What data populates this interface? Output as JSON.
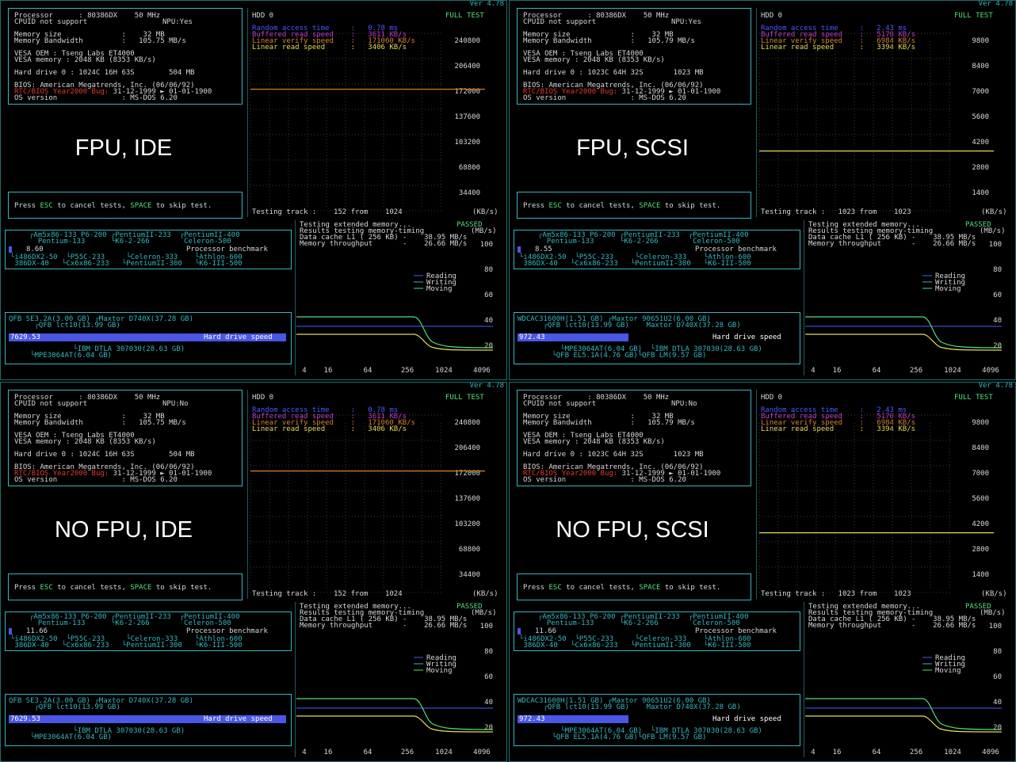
{
  "version": "Ver 4.78",
  "quads": [
    {
      "id": "q1",
      "label": "FPU, IDE",
      "npu": "NPU:Yes",
      "sys": {
        "processor": "Processor      : 80386DX    50 MHz",
        "cpuid": "CPUID not support",
        "mem_size": "Memory size              :    32 MB",
        "mem_bw": "Memory Bandwidth         :   105.75 MB/s",
        "vesa_oem": "VESA OEM : Tseng Labs ET4000",
        "vesa_mem": "VESA memory : 2048 KB (8353 KB/s)",
        "hd": "Hard drive 0 : 1024C 16H 63S        504 MB",
        "bios": "BIOS: American Megatrends, Inc. (06/06/92)",
        "y2k_red": "RTC/BIOS Year2000 Bug:",
        "y2k_rest": " 31-12-1999 ► 01-01-1900",
        "os": "OS version               : MS-DOS 6.20"
      },
      "press": {
        "a": "Press ",
        "esc": "ESC",
        "b": " to cancel tests, ",
        "space": "SPACE",
        "c": " to skip test."
      },
      "hdd": {
        "title": "HDD 0",
        "full": "FULL TEST",
        "rat": "Random access time     :   0.78 ms",
        "brs": "Buffered read speed    :   3611 KB/s",
        "lvs": "Linear verify speed    :   171060 KB/s",
        "lrs": "Linear read speed      :   3406 KB/s",
        "yticks": [
          "240800",
          "206400",
          "172000",
          "137600",
          "103200",
          "68800",
          "34400"
        ],
        "track": "Testing track :    152 from    1024",
        "unit": "(KB/s)",
        "line_level_pct": 0.714,
        "line_color": "#d8812a"
      },
      "bench": {
        "top1": "┌Am5x86-133 P6-200 ┌PentiumII-233  ┌PentiumII-400",
        "top2": "  Pentium-133      └K6-2-266        Celeron-500",
        "score": "8.60",
        "score_frac": 0.0,
        "cap": "Processor benchmark",
        "bot1": "└i486DX2-50  └P55C-233     └Celeron-333    └Athlon-600",
        "bot2": " 386DX-40   └Cx6x86-233   └PentiumII-300   └K6-III-500"
      },
      "hdbench": {
        "top1": "QFB SE3.2A(3.00 GB) ┌Maxtor D740X(37.28 GB)",
        "top2": "      ┌QFB lct10(13.99 GB)",
        "score": "7629.53",
        "bar_frac": 1.0,
        "cap": "Hard drive speed",
        "bot1": "               └IBM DTLA 307030(28.63 GB)",
        "bot2": "     └MPE3064AT(6.04 GB)"
      },
      "memtest": {
        "l1": "Testing extended memory...",
        "passed": "PASSED",
        "l2": "Results testing memory-timing",
        "unit": "(MB/s)",
        "l3": "Data cache L1 ( 256 KB) -    38.95 MB/s",
        "l4": "Memory throughput       -    26.66 MB/s",
        "yticks": [
          "100",
          "80",
          "60",
          "40",
          "20"
        ],
        "xticks": [
          "4",
          "16",
          "64",
          "256",
          "1024",
          "4096"
        ],
        "legend": [
          "Reading",
          "Writing",
          "Moving"
        ]
      }
    },
    {
      "id": "q2",
      "label": "FPU, SCSI",
      "npu": "NPU:Yes",
      "sys": {
        "processor": "Processor      : 80386DX    50 MHz",
        "cpuid": "CPUID not support",
        "mem_size": "Memory size              :    32 MB",
        "mem_bw": "Memory Bandwidth         :   105.79 MB/s",
        "vesa_oem": "VESA OEM : Tseng Labs ET4000",
        "vesa_mem": "VESA memory : 2048 KB (8353 KB/s)",
        "hd": "Hard drive 0 : 1023C 64H 32S       1023 MB",
        "bios": "BIOS: American Megatrends, Inc. (06/06/92)",
        "y2k_red": "RTC/BIOS Year2000 Bug:",
        "y2k_rest": " 31-12-1999 ► 01-01-1900",
        "os": "OS version               : MS-DOS 6.20"
      },
      "press": {
        "a": "Press ",
        "esc": "ESC",
        "b": " to cancel tests, ",
        "space": "SPACE",
        "c": " to skip test."
      },
      "hdd": {
        "title": "HDD 0",
        "full": "FULL TEST",
        "rat": "Random access time     :   2.43 ms",
        "brs": "Buffered read speed    :   5170 KB/s",
        "lvs": "Linear verify speed    :   6984 KB/s",
        "lrs": "Linear read speed      :   3394 KB/s",
        "yticks": [
          "9800",
          "8400",
          "7000",
          "5600",
          "4200",
          "2800",
          "1400"
        ],
        "track": "Testing track :   1023 from    1023",
        "unit": "(KB/s)",
        "line_level_pct": 0.346,
        "line_color": "#e3db55"
      },
      "bench": {
        "top1": "┌Am5x86-133 P6-200 ┌PentiumII-233  ┌PentiumII-400",
        "top2": "  Pentium-133      └K6-2-266        Celeron-500",
        "score": "8.55",
        "score_frac": 0.0,
        "cap": "Processor benchmark",
        "bot1": "└i486DX2-50  └P55C-233     └Celeron-333    └Athlon-600",
        "bot2": " 386DX-40   └Cx6x86-233   └PentiumII-300   └K6-III-500"
      },
      "hdbench": {
        "top1": "WDCAC31600H(1.51 GB) ┌Maxtor 90651U2(6.00 GB)",
        "top2": "      ┌QFB lct10(13.99 GB)    Maxtor D740X(37.28 GB)",
        "score": "972.43",
        "bar_frac": 0.4,
        "cap": "Hard drive speed",
        "bot1": "          └MPE3064AT(6.04 GB)  └IBM DTLA 307030(28.63 GB)",
        "bot2": "        └QFB EL5.1A(4.76 GB)└QFB LM(9.57 GB)"
      },
      "memtest": {
        "l1": "Testing extended memory...",
        "passed": "PASSED",
        "l2": "Results testing memory-timing",
        "unit": "(MB/s)",
        "l3": "Data cache L1 ( 256 KB) -    38.95 MB/s",
        "l4": "Memory throughput       -    26.66 MB/s",
        "yticks": [
          "100",
          "80",
          "60",
          "40",
          "20"
        ],
        "xticks": [
          "4",
          "16",
          "64",
          "256",
          "1024",
          "4096"
        ],
        "legend": [
          "Reading",
          "Writing",
          "Moving"
        ]
      }
    },
    {
      "id": "q3",
      "label": "NO FPU, IDE",
      "npu": "NPU:No",
      "sys": {
        "processor": "Processor      : 80386DX    50 MHz",
        "cpuid": "CPUID not support",
        "mem_size": "Memory size              :    32 MB",
        "mem_bw": "Memory Bandwidth         :   105.75 MB/s",
        "vesa_oem": "VESA OEM : Tseng Labs ET4000",
        "vesa_mem": "VESA memory : 2048 KB (8353 KB/s)",
        "hd": "Hard drive 0 : 1024C 16H 63S        504 MB",
        "bios": "BIOS: American Megatrends, Inc. (06/06/92)",
        "y2k_red": "RTC/BIOS Year2000 Bug:",
        "y2k_rest": " 31-12-1999 ► 01-01-1900",
        "os": "OS version               : MS-DOS 6.20"
      },
      "press": {
        "a": "Press ",
        "esc": "ESC",
        "b": " to cancel tests, ",
        "space": "SPACE",
        "c": " to skip test."
      },
      "hdd": {
        "title": "HDD 0",
        "full": "FULL TEST",
        "rat": "Random access time     :   0.78 ms",
        "brs": "Buffered read speed    :   3611 KB/s",
        "lvs": "Linear verify speed    :   171060 KB/s",
        "lrs": "Linear read speed      :   3406 KB/s",
        "yticks": [
          "240800",
          "206400",
          "172000",
          "137600",
          "103200",
          "68800",
          "34400"
        ],
        "track": "Testing track :    152 from    1024",
        "unit": "(KB/s)",
        "line_level_pct": 0.714,
        "line_color": "#d8812a"
      },
      "bench": {
        "top1": "┌Am5x86-133 P6-200 ┌PentiumII-233  ┌PentiumII-400",
        "top2": "  Pentium-133      └K6-2-266        Celeron-500",
        "score": "11.66",
        "score_frac": 0.0,
        "cap": "Processor benchmark",
        "bot1": "└i486DX2-50  └P55C-233     └Celeron-333    └Athlon-600",
        "bot2": " 386DX-40   └Cx6x86-233   └PentiumII-300   └K6-III-500"
      },
      "hdbench": {
        "top1": "QFB SE3.2A(3.00 GB) ┌Maxtor D740X(37.28 GB)",
        "top2": "      ┌QFB lct10(13.99 GB)",
        "score": "7629.53",
        "bar_frac": 1.0,
        "cap": "Hard drive speed",
        "bot1": "               └IBM DTLA 307030(28.63 GB)",
        "bot2": "     └MPE3064AT(6.04 GB)"
      },
      "memtest": {
        "l1": "Testing extended memory...",
        "passed": "PASSED",
        "l2": "Results testing memory-timing",
        "unit": "(MB/s)",
        "l3": "Data cache L1 ( 256 KB) -    38.95 MB/s",
        "l4": "Memory throughput       -    26.66 MB/s",
        "yticks": [
          "100",
          "80",
          "60",
          "40",
          "20"
        ],
        "xticks": [
          "4",
          "16",
          "64",
          "256",
          "1024",
          "4096"
        ],
        "legend": [
          "Reading",
          "Writing",
          "Moving"
        ]
      }
    },
    {
      "id": "q4",
      "label": "NO FPU, SCSI",
      "npu": "NPU:No",
      "sys": {
        "processor": "Processor      : 80386DX    50 MHz",
        "cpuid": "CPUID not support",
        "mem_size": "Memory size              :    32 MB",
        "mem_bw": "Memory Bandwidth         :   105.79 MB/s",
        "vesa_oem": "VESA OEM : Tseng Labs ET4000",
        "vesa_mem": "VESA memory : 2048 KB (8353 KB/s)",
        "hd": "Hard drive 0 : 1023C 64H 32S       1023 MB",
        "bios": "BIOS: American Megatrends, Inc. (06/06/92)",
        "y2k_red": "RTC/BIOS Year2000 Bug:",
        "y2k_rest": " 31-12-1999 ► 01-01-1900",
        "os": "OS version               : MS-DOS 6.20"
      },
      "press": {
        "a": "Press ",
        "esc": "ESC",
        "b": " to cancel tests, ",
        "space": "SPACE",
        "c": " to skip test."
      },
      "hdd": {
        "title": "HDD 0",
        "full": "FULL TEST",
        "rat": "Random access time     :   2.43 ms",
        "brs": "Buffered read speed    :   5170 KB/s",
        "lvs": "Linear verify speed    :   6984 KB/s",
        "lrs": "Linear read speed      :   3394 KB/s",
        "yticks": [
          "9800",
          "8400",
          "7000",
          "5600",
          "4200",
          "2800",
          "1400"
        ],
        "track": "Testing track :   1023 from    1023",
        "unit": "(KB/s)",
        "line_level_pct": 0.346,
        "line_color": "#e3db55"
      },
      "bench": {
        "top1": "┌Am5x86-133 P6-200 ┌PentiumII-233  ┌PentiumII-400",
        "top2": "  Pentium-133      └K6-2-266        Celeron-500",
        "score": "11.66",
        "score_frac": 0.0,
        "cap": "Processor benchmark",
        "bot1": "└i486DX2-50  └P55C-233     └Celeron-333    └Athlon-600",
        "bot2": " 386DX-40   └Cx6x86-233   └PentiumII-300   └K6-III-500"
      },
      "hdbench": {
        "top1": "WDCAC31600H(1.51 GB) ┌Maxtor 90651U2(6.00 GB)",
        "top2": "      ┌QFB lct10(13.99 GB)    Maxtor D740X(37.28 GB)",
        "score": "972.43",
        "bar_frac": 0.4,
        "cap": "Hard drive speed",
        "bot1": "          └MPE3064AT(6.04 GB)  └IBM DTLA 307030(28.63 GB)",
        "bot2": "        └QFB EL5.1A(4.76 GB)└QFB LM(9.57 GB)"
      },
      "memtest": {
        "l1": "Testing extended memory...",
        "passed": "PASSED",
        "l2": "Results testing memory-timing",
        "unit": "(MB/s)",
        "l3": "Data cache L1 ( 256 KB) -    38.95 MB/s",
        "l4": "Memory throughput       -    26.66 MB/s",
        "yticks": [
          "100",
          "80",
          "60",
          "40",
          "20"
        ],
        "xticks": [
          "4",
          "16",
          "64",
          "256",
          "1024",
          "4096"
        ],
        "legend": [
          "Reading",
          "Writing",
          "Moving"
        ]
      }
    }
  ]
}
